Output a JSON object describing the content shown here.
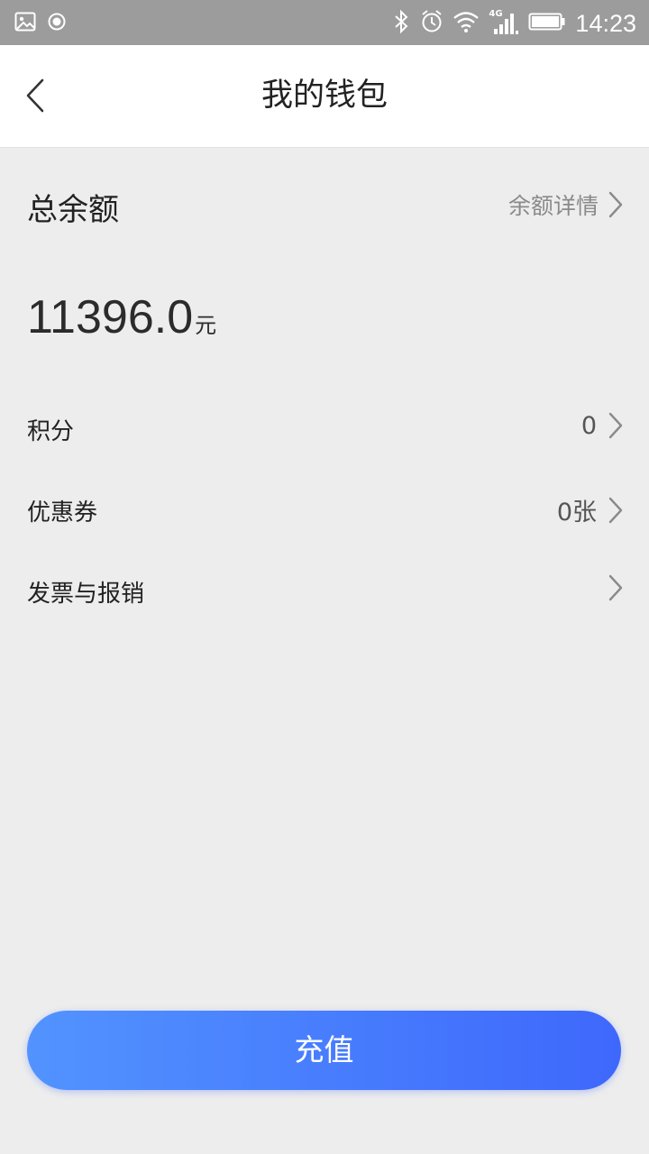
{
  "status_bar": {
    "time": "14:23",
    "network": "4G",
    "icons_left": [
      "image-icon",
      "record-icon"
    ],
    "icons_right": [
      "bluetooth-icon",
      "alarm-icon",
      "wifi-icon",
      "signal-icon",
      "battery-icon"
    ]
  },
  "header": {
    "title": "我的钱包",
    "back_icon": "chevron-left-icon"
  },
  "balance": {
    "label": "总余额",
    "detail_link": "余额详情",
    "amount": "11396.0",
    "unit": "元"
  },
  "rows": [
    {
      "label": "积分",
      "value": "0"
    },
    {
      "label": "优惠券",
      "value": "0张"
    },
    {
      "label": "发票与报销",
      "value": ""
    }
  ],
  "recharge_button": {
    "label": "充值",
    "gradient_start": "#5293ff",
    "gradient_end": "#3e68fc"
  },
  "colors": {
    "background": "#ededed",
    "status_bar": "#9c9c9c",
    "accent": "#4a7dfd"
  }
}
